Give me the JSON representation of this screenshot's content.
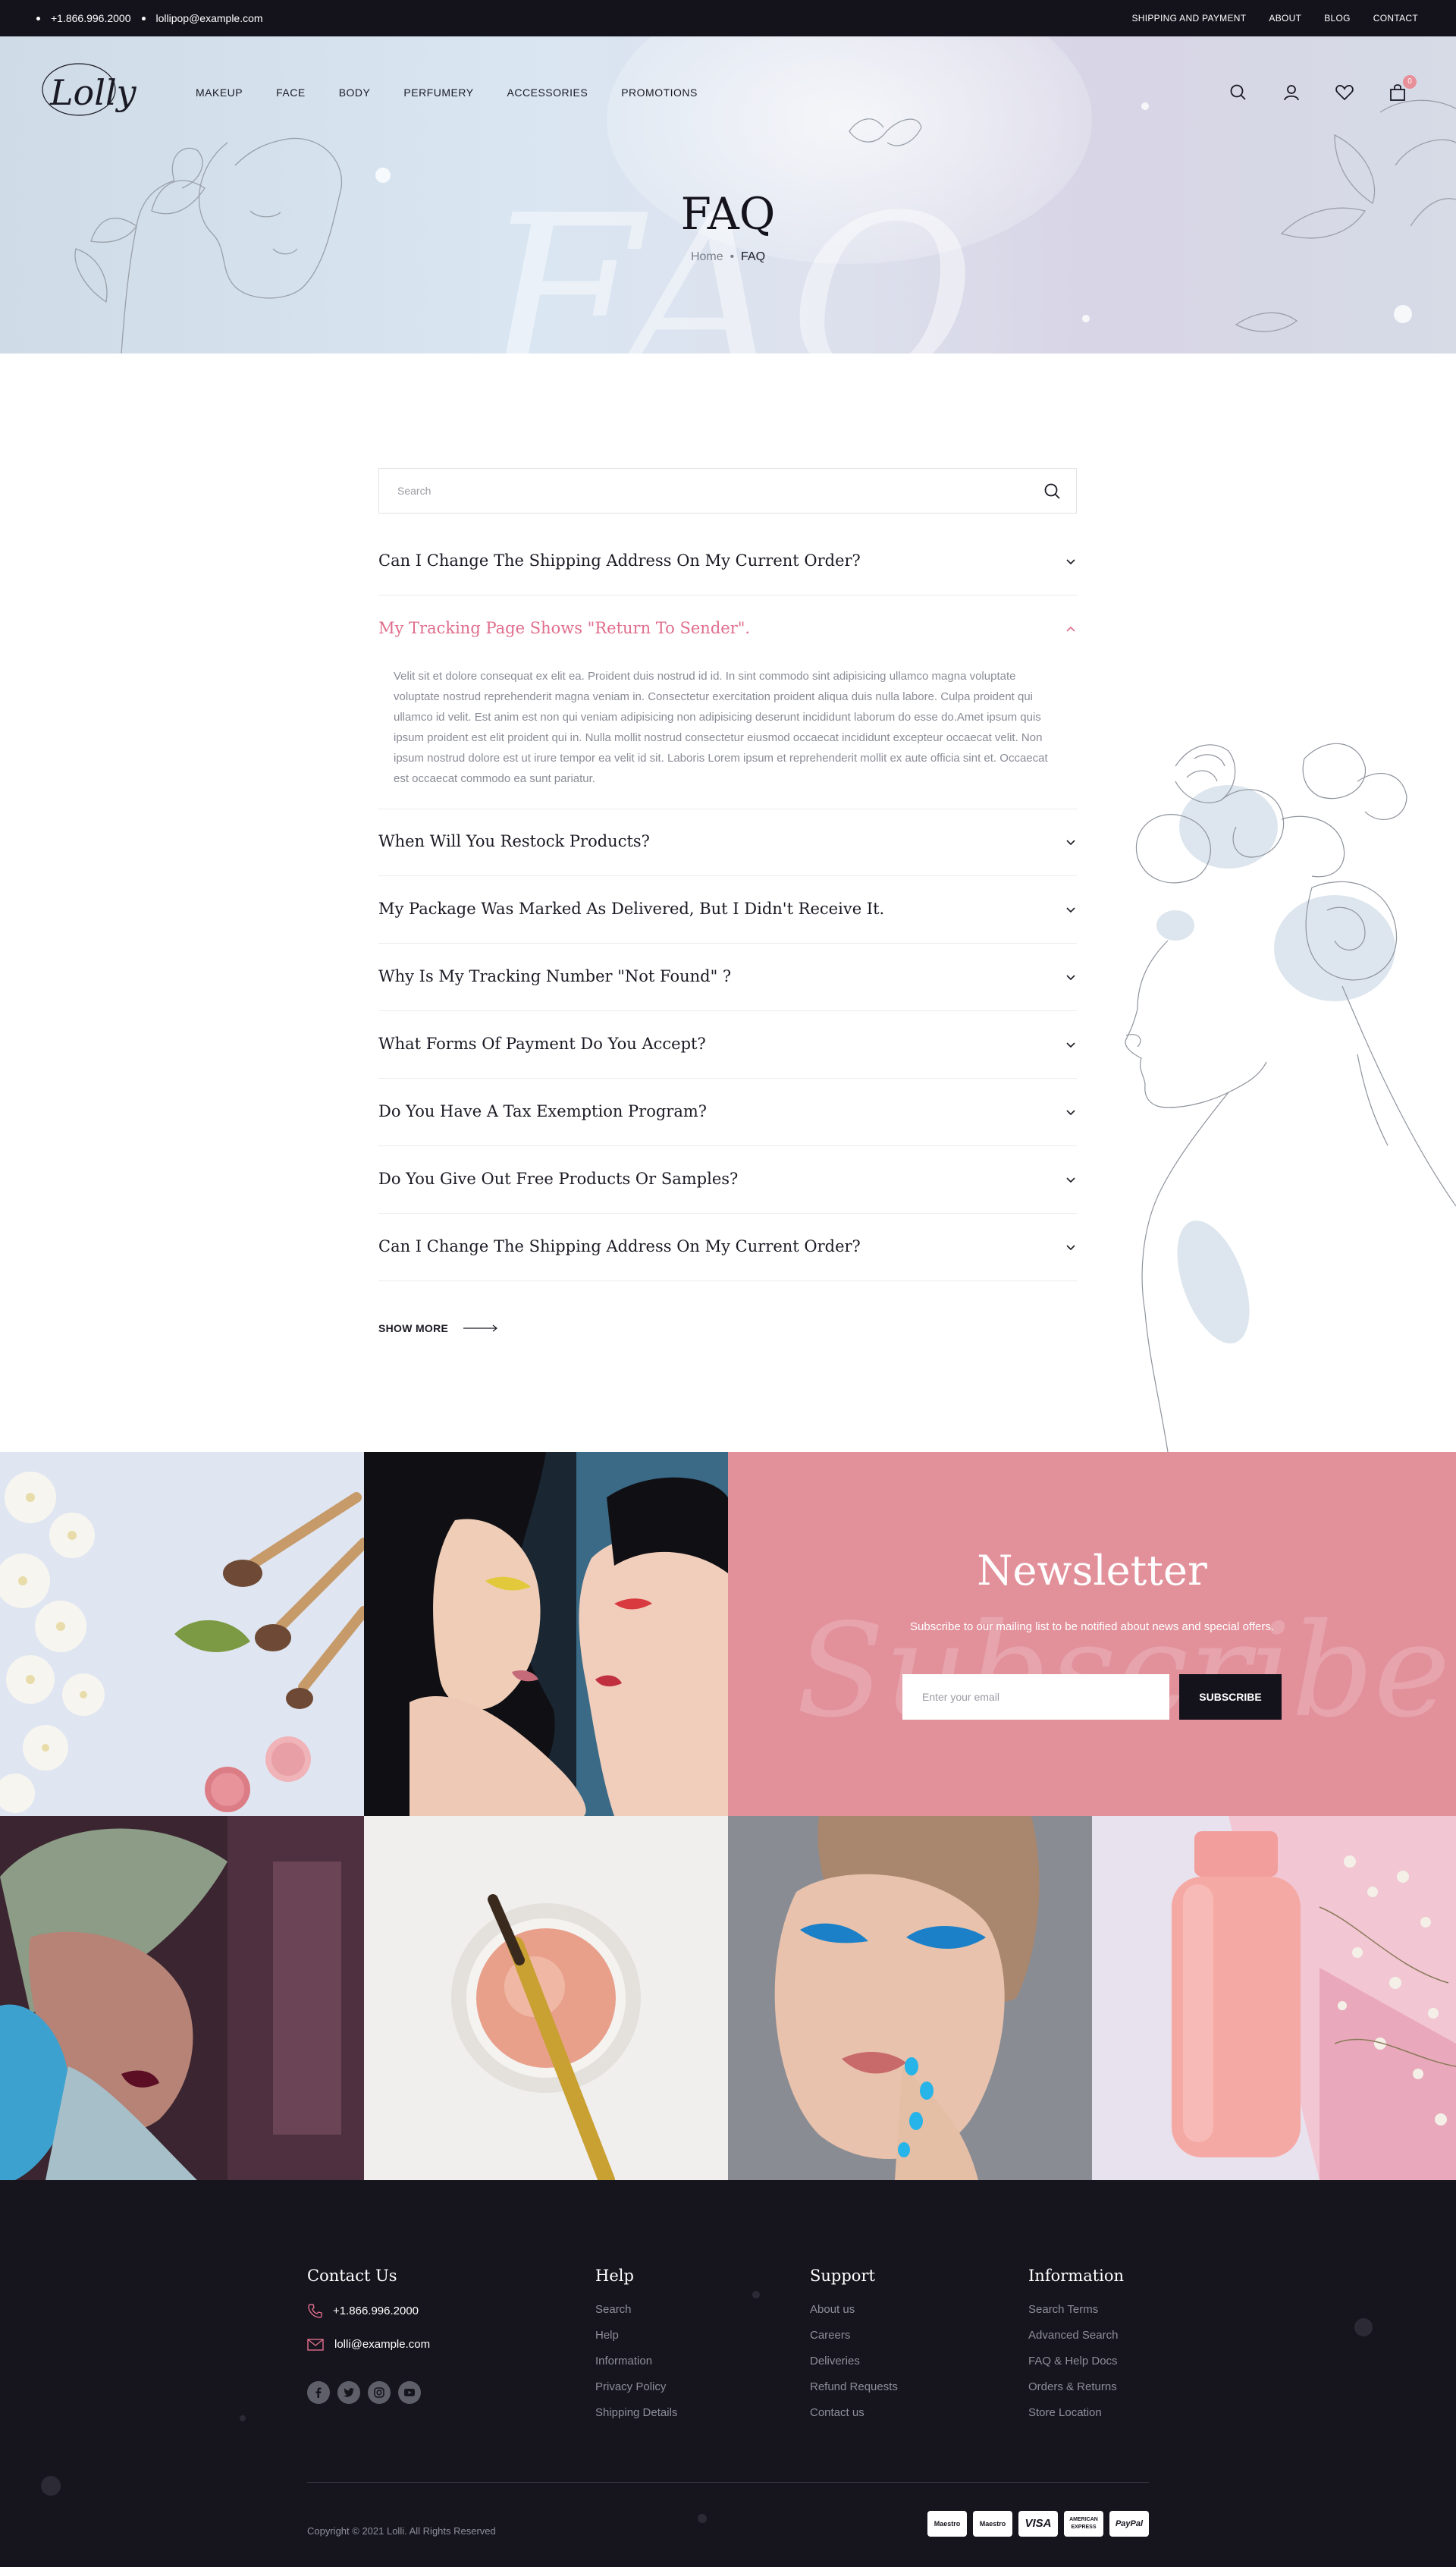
{
  "topbar": {
    "phone": "+1.866.996.2000",
    "email": "lollipop@example.com",
    "links": [
      "SHIPPING AND PAYMENT",
      "ABOUT",
      "BLOG",
      "CONTACT"
    ]
  },
  "header": {
    "logo_text": "Lolly",
    "nav": [
      "MAKEUP",
      "FACE",
      "BODY",
      "PERFUMERY",
      "ACCESSORIES",
      "PROMOTIONS"
    ],
    "cart_count": "0",
    "icons": [
      "search-icon",
      "user-icon",
      "heart-icon",
      "bag-icon"
    ]
  },
  "hero": {
    "title": "FAQ",
    "bg_script": "FAQ",
    "breadcrumb_home": "Home",
    "breadcrumb_sep": "•",
    "breadcrumb_current": "FAQ"
  },
  "faq": {
    "search_placeholder": "Search",
    "items": [
      {
        "question": "Can I Change The Shipping Address On My Current Order?",
        "open": false
      },
      {
        "question": "My Tracking Page Shows \"Return To Sender\".",
        "open": true,
        "answer": "Velit sit et dolore consequat ex elit ea. Proident duis nostrud id id. In sint commodo sint adipisicing ullamco magna voluptate voluptate nostrud reprehenderit magna veniam in. Consectetur exercitation proident aliqua duis nulla labore. Culpa proident qui ullamco id velit. Est anim est non qui veniam adipisicing non adipisicing deserunt incididunt laborum do esse do.Amet ipsum quis ipsum proident est elit proident qui in. Nulla mollit nostrud consectetur eiusmod occaecat incididunt excepteur occaecat velit. Non ipsum nostrud dolore est ut irure tempor ea velit id sit. Laboris Lorem ipsum et reprehenderit mollit ex aute officia sint et. Occaecat est occaecat commodo ea sunt pariatur."
      },
      {
        "question": "When Will You Restock Products?",
        "open": false
      },
      {
        "question": "My Package Was Marked As Delivered, But I Didn't Receive It.",
        "open": false
      },
      {
        "question": "Why Is My Tracking Number \"Not Found\" ?",
        "open": false
      },
      {
        "question": "What Forms Of Payment Do You Accept?",
        "open": false
      },
      {
        "question": "Do You Have A Tax Exemption Program?",
        "open": false
      },
      {
        "question": "Do You Give Out Free Products Or Samples?",
        "open": false
      },
      {
        "question": "Can I Change The Shipping Address On My Current Order?",
        "open": false
      }
    ],
    "show_more": "SHOW MORE"
  },
  "newsletter": {
    "title": "Newsletter",
    "subtitle": "Subscribe to our mailing list to be notified about news and special offers.",
    "input_placeholder": "Enter your email",
    "button": "SUBSCRIBE",
    "bg_script": "Subscribe"
  },
  "footer": {
    "contact_title": "Contact Us",
    "phone": "+1.866.996.2000",
    "email": "lolli@example.com",
    "socials": [
      "facebook-icon",
      "twitter-icon",
      "instagram-icon",
      "youtube-icon"
    ],
    "help": {
      "title": "Help",
      "links": [
        "Search",
        "Help",
        "Information",
        "Privacy Policy",
        "Shipping Details"
      ]
    },
    "support": {
      "title": "Support",
      "links": [
        "About us",
        "Careers",
        "Deliveries",
        "Refund Requests",
        "Contact us"
      ]
    },
    "information": {
      "title": "Information",
      "links": [
        "Search Terms",
        "Advanced Search",
        "FAQ & Help Docs",
        "Orders & Returns",
        "Store Location"
      ]
    },
    "copyright": "Copyright © 2021 Lolli.  All Rights Reserved",
    "payments": [
      "Maestro",
      "Maestro",
      "VISA",
      "AMERICAN EXPRESS",
      "PayPal"
    ]
  },
  "colors": {
    "accent": "#e06d8b",
    "dark": "#14131c",
    "newsletter_bg": "#e2919b"
  }
}
